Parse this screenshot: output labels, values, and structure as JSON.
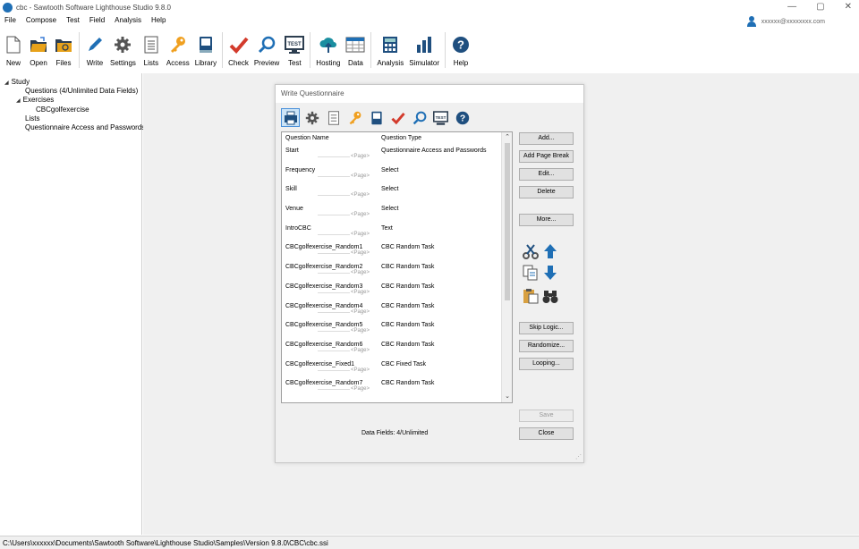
{
  "window": {
    "title": "cbc - Sawtooth Software Lighthouse Studio 9.8.0",
    "controls": [
      "—",
      "▢",
      "✕"
    ]
  },
  "menu": [
    "File",
    "Compose",
    "Test",
    "Field",
    "Analysis",
    "Help"
  ],
  "user": {
    "email": "xxxxxx@xxxxxxxx.com"
  },
  "toolbar": {
    "items": [
      {
        "label": "New",
        "icon": "new-file-icon"
      },
      {
        "label": "Open",
        "icon": "open-folder-icon"
      },
      {
        "label": "Files",
        "icon": "files-folder-icon"
      },
      {
        "label": "Write",
        "icon": "pencil-icon"
      },
      {
        "label": "Settings",
        "icon": "gear-icon"
      },
      {
        "label": "Lists",
        "icon": "list-icon"
      },
      {
        "label": "Access",
        "icon": "key-icon"
      },
      {
        "label": "Library",
        "icon": "book-icon"
      },
      {
        "label": "Check",
        "icon": "checkmark-icon"
      },
      {
        "label": "Preview",
        "icon": "magnifier-icon"
      },
      {
        "label": "Test",
        "icon": "test-monitor-icon"
      },
      {
        "label": "Hosting",
        "icon": "cloud-upload-icon"
      },
      {
        "label": "Data",
        "icon": "data-grid-icon"
      },
      {
        "label": "Analysis",
        "icon": "calculator-icon"
      },
      {
        "label": "Simulator",
        "icon": "bar-chart-icon"
      },
      {
        "label": "Help",
        "icon": "help-icon"
      }
    ],
    "test_badge": "TEST"
  },
  "tree": {
    "study": "Study",
    "questions": "Questions (4/Unlimited Data Fields)",
    "exercises": "Exercises",
    "exercise_item": "CBCgolfexercise",
    "lists": "Lists",
    "access": "Questionnaire Access and Passwords"
  },
  "dialog": {
    "title": "Write Questionnaire",
    "columns": [
      "Question Name",
      "Question Type"
    ],
    "page_label": "<Page>",
    "rows": [
      {
        "name": "Start",
        "type": "Questionnaire Access and Passwords"
      },
      {
        "name": "Frequency",
        "type": "Select"
      },
      {
        "name": "Skill",
        "type": "Select"
      },
      {
        "name": "Venue",
        "type": "Select"
      },
      {
        "name": "IntroCBC",
        "type": "Text"
      },
      {
        "name": "CBCgolfexercise_Random1",
        "type": "CBC Random Task"
      },
      {
        "name": "CBCgolfexercise_Random2",
        "type": "CBC Random Task"
      },
      {
        "name": "CBCgolfexercise_Random3",
        "type": "CBC Random Task"
      },
      {
        "name": "CBCgolfexercise_Random4",
        "type": "CBC Random Task"
      },
      {
        "name": "CBCgolfexercise_Random5",
        "type": "CBC Random Task"
      },
      {
        "name": "CBCgolfexercise_Random6",
        "type": "CBC Random Task"
      },
      {
        "name": "CBCgolfexercise_Fixed1",
        "type": "CBC Fixed Task"
      },
      {
        "name": "CBCgolfexercise_Random7",
        "type": "CBC Random Task"
      }
    ],
    "buttons": {
      "add": "Add...",
      "add_page_break": "Add Page Break",
      "edit": "Edit...",
      "delete": "Delete",
      "more": "More...",
      "skip_logic": "Skip Logic...",
      "randomize": "Randomize...",
      "looping": "Looping...",
      "save": "Save",
      "close": "Close"
    },
    "data_fields": "Data Fields: 4/Unlimited",
    "scroll_up": "⌃",
    "scroll_down": "⌄"
  },
  "statusbar": {
    "path": "C:\\Users\\xxxxxx\\Documents\\Sawtooth Software\\Lighthouse Studio\\Samples\\Version 9.8.0\\CBC\\cbc.ssi"
  },
  "colors": {
    "accent_blue": "#1f6fb5",
    "check_red": "#d33b2c",
    "key_orange": "#f0a020"
  }
}
